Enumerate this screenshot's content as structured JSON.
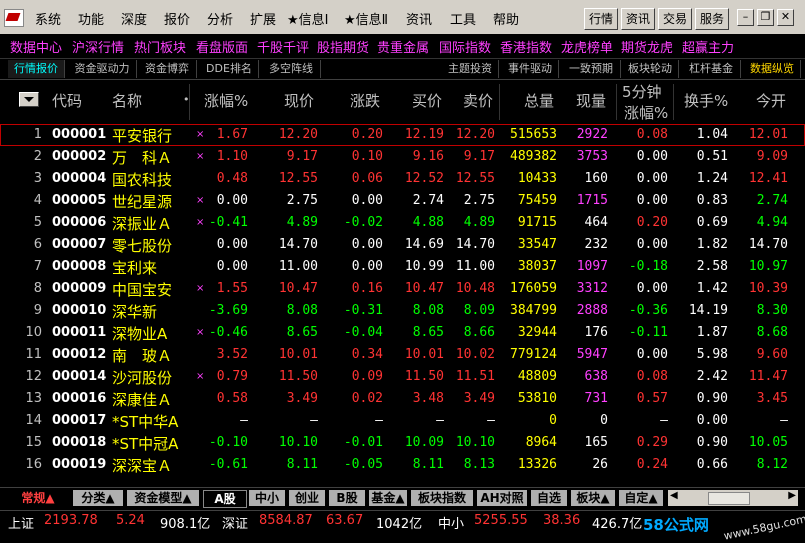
{
  "menubar": {
    "items": [
      "系统",
      "功能",
      "深度",
      "报价",
      "分析",
      "扩展",
      "★信息Ⅰ",
      "★信息Ⅱ",
      "资讯",
      "工具",
      "帮助"
    ],
    "buttons": [
      "行情",
      "资讯",
      "交易",
      "服务"
    ],
    "window_controls": [
      "minimize",
      "restore",
      "close"
    ]
  },
  "navbar": {
    "links": [
      "数据中心",
      "沪深行情",
      "热门板块",
      "看盘版面",
      "千股千评",
      "股指期货",
      "贵重金属",
      "国际指数",
      "香港指数",
      "龙虎榜单",
      "期货龙虎",
      "超赢主力"
    ]
  },
  "view_tabs": {
    "left": [
      "行情报价",
      "资金驱动力",
      "资金博弈",
      "DDE排名",
      "多空阵线"
    ],
    "right": [
      "主题投资",
      "事件驱动",
      "一致预期",
      "板块轮动",
      "杠杆基金",
      "数据纵览"
    ]
  },
  "table": {
    "headers": {
      "code": "代码",
      "name": "名称",
      "dot": "•",
      "pct": "涨幅%",
      "price": "现价",
      "change": "涨跌",
      "bid": "买价",
      "ask": "卖价",
      "volume": "总量",
      "cur_vol": "现量",
      "min5_top": "5分钟",
      "min5_bottom": "涨幅%",
      "turnover": "换手%",
      "open": "今开"
    },
    "rows": [
      {
        "idx": "1",
        "code": "000001",
        "name": "平安银行",
        "mark": "×",
        "pct": "1.67",
        "price": "12.20",
        "change": "0.20",
        "bid": "12.19",
        "ask": "12.20",
        "volume": "515653",
        "cur_vol": "2922",
        "min5": "0.08",
        "turnover": "1.04",
        "open": "12.01"
      },
      {
        "idx": "2",
        "code": "000002",
        "name": "万　科Ａ",
        "mark": "×",
        "pct": "1.10",
        "price": "9.17",
        "change": "0.10",
        "bid": "9.16",
        "ask": "9.17",
        "volume": "489382",
        "cur_vol": "3753",
        "min5": "0.00",
        "turnover": "0.51",
        "open": "9.09"
      },
      {
        "idx": "3",
        "code": "000004",
        "name": "国农科技",
        "mark": "",
        "pct": "0.48",
        "price": "12.55",
        "change": "0.06",
        "bid": "12.52",
        "ask": "12.55",
        "volume": "10433",
        "cur_vol": "160",
        "min5": "0.00",
        "turnover": "1.24",
        "open": "12.41"
      },
      {
        "idx": "4",
        "code": "000005",
        "name": "世纪星源",
        "mark": "×",
        "pct": "0.00",
        "price": "2.75",
        "change": "0.00",
        "bid": "2.74",
        "ask": "2.75",
        "volume": "75459",
        "cur_vol": "1715",
        "min5": "0.00",
        "turnover": "0.83",
        "open": "2.74"
      },
      {
        "idx": "5",
        "code": "000006",
        "name": "深振业Ａ",
        "mark": "×",
        "pct": "-0.41",
        "price": "4.89",
        "change": "-0.02",
        "bid": "4.88",
        "ask": "4.89",
        "volume": "91715",
        "cur_vol": "464",
        "min5": "0.20",
        "turnover": "0.69",
        "open": "4.94"
      },
      {
        "idx": "6",
        "code": "000007",
        "name": "零七股份",
        "mark": "",
        "pct": "0.00",
        "price": "14.70",
        "change": "0.00",
        "bid": "14.69",
        "ask": "14.70",
        "volume": "33547",
        "cur_vol": "232",
        "min5": "0.00",
        "turnover": "1.82",
        "open": "14.70"
      },
      {
        "idx": "7",
        "code": "000008",
        "name": "宝利来",
        "mark": "",
        "pct": "0.00",
        "price": "11.00",
        "change": "0.00",
        "bid": "10.99",
        "ask": "11.00",
        "volume": "38037",
        "cur_vol": "1097",
        "min5": "-0.18",
        "turnover": "2.58",
        "open": "10.97"
      },
      {
        "idx": "8",
        "code": "000009",
        "name": "中国宝安",
        "mark": "×",
        "pct": "1.55",
        "price": "10.47",
        "change": "0.16",
        "bid": "10.47",
        "ask": "10.48",
        "volume": "176059",
        "cur_vol": "3312",
        "min5": "0.00",
        "turnover": "1.42",
        "open": "10.39"
      },
      {
        "idx": "9",
        "code": "000010",
        "name": "深华新",
        "mark": "",
        "pct": "-3.69",
        "price": "8.08",
        "change": "-0.31",
        "bid": "8.08",
        "ask": "8.09",
        "volume": "384799",
        "cur_vol": "2888",
        "min5": "-0.36",
        "turnover": "14.19",
        "open": "8.30"
      },
      {
        "idx": "10",
        "code": "000011",
        "name": "深物业A",
        "mark": "×",
        "pct": "-0.46",
        "price": "8.65",
        "change": "-0.04",
        "bid": "8.65",
        "ask": "8.66",
        "volume": "32944",
        "cur_vol": "176",
        "min5": "-0.11",
        "turnover": "1.87",
        "open": "8.68"
      },
      {
        "idx": "11",
        "code": "000012",
        "name": "南　玻Ａ",
        "mark": "",
        "pct": "3.52",
        "price": "10.01",
        "change": "0.34",
        "bid": "10.01",
        "ask": "10.02",
        "volume": "779124",
        "cur_vol": "5947",
        "min5": "0.00",
        "turnover": "5.98",
        "open": "9.60"
      },
      {
        "idx": "12",
        "code": "000014",
        "name": "沙河股份",
        "mark": "×",
        "pct": "0.79",
        "price": "11.50",
        "change": "0.09",
        "bid": "11.50",
        "ask": "11.51",
        "volume": "48809",
        "cur_vol": "638",
        "min5": "0.08",
        "turnover": "2.42",
        "open": "11.47"
      },
      {
        "idx": "13",
        "code": "000016",
        "name": "深康佳Ａ",
        "mark": "",
        "pct": "0.58",
        "price": "3.49",
        "change": "0.02",
        "bid": "3.48",
        "ask": "3.49",
        "volume": "53810",
        "cur_vol": "731",
        "min5": "0.57",
        "turnover": "0.90",
        "open": "3.45"
      },
      {
        "idx": "14",
        "code": "000017",
        "name": "*ST中华A",
        "mark": "",
        "pct": "–",
        "price": "–",
        "change": "–",
        "bid": "–",
        "ask": "–",
        "volume": "0",
        "cur_vol": "0",
        "min5": "–",
        "turnover": "0.00",
        "open": "–"
      },
      {
        "idx": "15",
        "code": "000018",
        "name": "*ST中冠A",
        "mark": "",
        "pct": "-0.10",
        "price": "10.10",
        "change": "-0.01",
        "bid": "10.09",
        "ask": "10.10",
        "volume": "8964",
        "cur_vol": "165",
        "min5": "0.29",
        "turnover": "0.90",
        "open": "10.05"
      },
      {
        "idx": "16",
        "code": "000019",
        "name": "深深宝Ａ",
        "mark": "",
        "pct": "-0.61",
        "price": "8.11",
        "change": "-0.05",
        "bid": "8.11",
        "ask": "8.13",
        "volume": "13326",
        "cur_vol": "26",
        "min5": "0.24",
        "turnover": "0.66",
        "open": "8.12"
      }
    ]
  },
  "bottom_tabs": [
    "常规▲",
    "分类▲",
    "资金模型▲",
    "A股",
    "中小",
    "创业",
    "B股",
    "基金▲",
    "板块指数",
    "AH对照",
    "自选",
    "板块▲",
    "自定▲"
  ],
  "statusbar": {
    "sh_label": "上证",
    "sh_value": "2193.78",
    "sh_change": "5.24",
    "sh_amount": "908.1亿",
    "sz_label": "深证",
    "sz_value": "8584.87",
    "sz_change": "63.67",
    "sz_amount": "1042亿",
    "zx_label": "中小",
    "zx_value": "5255.55",
    "zx_change": "38.36",
    "zx_amount": "426.7亿"
  },
  "watermark": {
    "logo": "58公式网",
    "url": "www.58gu.com"
  },
  "colors": {
    "up": "#ff3333",
    "down": "#00ff00",
    "flat": "#ffffff",
    "name": "#ffff00",
    "volume": "#ffff00",
    "menu_bg": "#d4d0c8",
    "nav_link": "#ff40ff"
  }
}
